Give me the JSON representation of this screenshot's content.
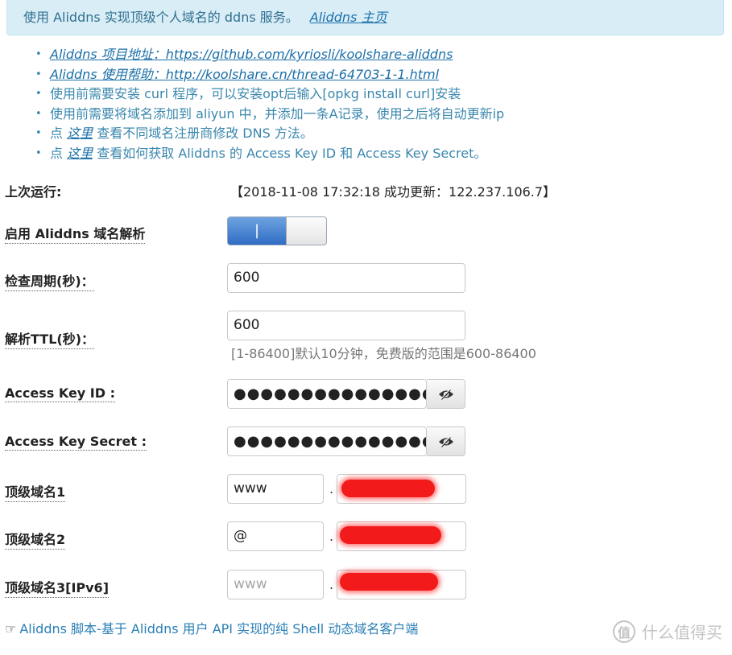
{
  "banner": {
    "text": "使用 Aliddns 实现顶级个人域名的 ddns 服务。",
    "link": "Aliddns 主页"
  },
  "notes": [
    {
      "parts": [
        {
          "t": "Aliddns 项目地址：https://github.com/kyriosli/koolshare-aliddns",
          "link": true
        }
      ]
    },
    {
      "parts": [
        {
          "t": "Aliddns 使用帮助：http://koolshare.cn/thread-64703-1-1.html",
          "link": true
        }
      ]
    },
    {
      "parts": [
        {
          "t": "使用前需要安装 curl 程序，可以安装opt后输入[opkg install curl]安装",
          "link": false
        }
      ]
    },
    {
      "parts": [
        {
          "t": "使用前需要将域名添加到 aliyun 中，并添加一条A记录，使用之后将自动更新ip",
          "link": false
        }
      ]
    },
    {
      "parts": [
        {
          "t": "点 ",
          "link": false
        },
        {
          "t": "这里",
          "link": true
        },
        {
          "t": " 查看不同域名注册商修改 DNS 方法。",
          "link": false
        }
      ]
    },
    {
      "parts": [
        {
          "t": "点 ",
          "link": false
        },
        {
          "t": "这里",
          "link": true
        },
        {
          "t": " 查看如何获取 Aliddns 的 Access Key ID 和 Access Key Secret。",
          "link": false
        }
      ]
    }
  ],
  "form": {
    "last_run_label": "上次运行:",
    "last_run_value": "【2018-11-08 17:32:18 成功更新：122.237.106.7】",
    "enable_label": "启用 Aliddns 域名解析",
    "switch_on_glyph": "|",
    "interval_label": "检查周期(秒)：",
    "interval_value": "600",
    "ttl_label": "解析TTL(秒)：",
    "ttl_value": "600",
    "ttl_hint": "[1-86400]默认10分钟，免费版的范围是600-86400",
    "key_id_label": "Access Key ID :",
    "key_id_value": "●●●●●●●●●●●●●●●●",
    "key_secret_label": "Access Key Secret :",
    "key_secret_value": "●●●●●●●●●●●●●●●●●●●●●●●●●●●●●●",
    "domain1_label": "顶级域名1",
    "domain1_host": "www",
    "domain2_label": "顶级域名2",
    "domain2_host": "@",
    "domain3_label": "顶级域名3[IPv6]",
    "domain3_host_placeholder": "www",
    "dot": "."
  },
  "footer": {
    "text": "Aliddns 脚本-基于 Aliddns 用户 API 实现的纯 Shell 动态域名客户端"
  },
  "watermark": {
    "badge": "值",
    "text": "什么值得买"
  },
  "icons": {
    "eye": "eye-toggle-icon",
    "hand": "pointing-hand-icon"
  },
  "colors": {
    "banner_bg": "#d9edf7",
    "link": "#1a6fa8",
    "switch_on": "#2f6cc4",
    "redaction": "#f21a1a"
  }
}
